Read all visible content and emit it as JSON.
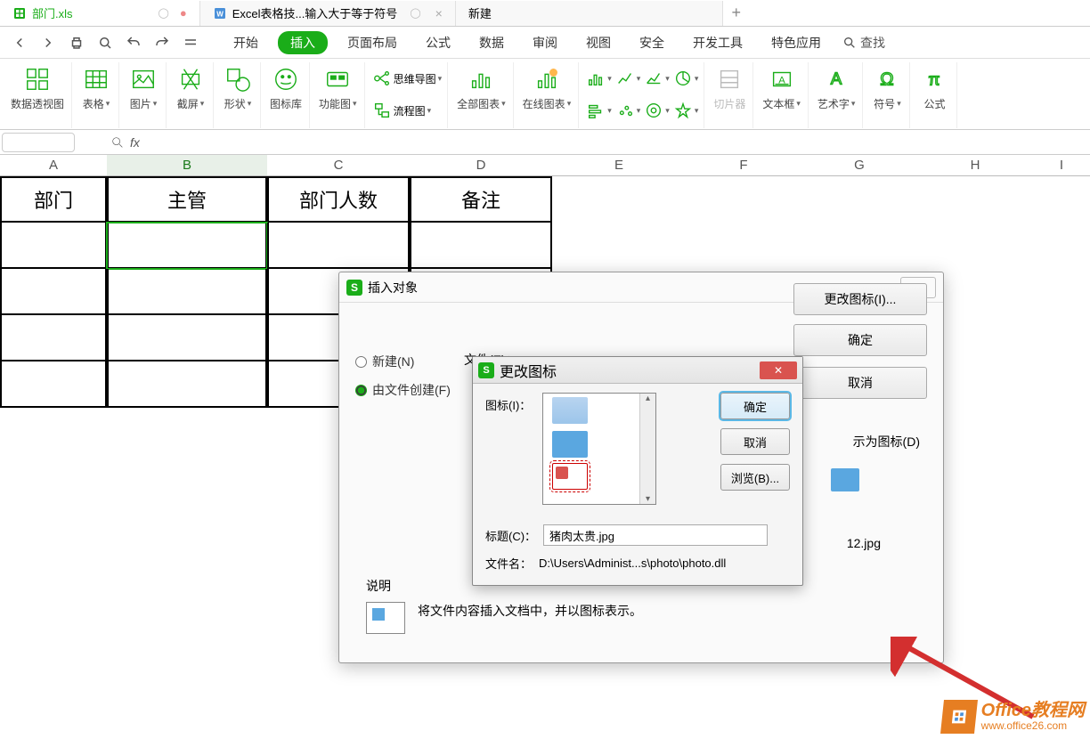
{
  "tabs": {
    "t1": "部门.xls",
    "t2": "Excel表格技...输入大于等于符号",
    "t3": "新建"
  },
  "menus": {
    "m1": "开始",
    "m2": "插入",
    "m3": "页面布局",
    "m4": "公式",
    "m5": "数据",
    "m6": "审阅",
    "m7": "视图",
    "m8": "安全",
    "m9": "开发工具",
    "m10": "特色应用",
    "find": "查找"
  },
  "ribbon": {
    "pivot": "数据透视图",
    "table": "表格",
    "pic": "图片",
    "screenshot": "截屏",
    "shape": "形状",
    "iconlib": "图标库",
    "func": "功能图",
    "mindmap": "思维导图",
    "flowchart": "流程图",
    "allchart": "全部图表",
    "onlinechart": "在线图表",
    "slice": "切片器",
    "textbox": "文本框",
    "wordart": "艺术字",
    "symbol": "符号",
    "formula": "公式"
  },
  "columns": {
    "A": "A",
    "B": "B",
    "C": "C",
    "D": "D",
    "E": "E",
    "F": "F",
    "G": "G",
    "H": "H",
    "I": "I"
  },
  "row1": {
    "A": "部门",
    "B": "主管",
    "C": "部门人数",
    "D": "备注"
  },
  "dlg1": {
    "title": "插入对象",
    "radio_new": "新建(N)",
    "radio_file": "由文件创建(F)",
    "file_label": "文件(E)：",
    "ok": "确定",
    "cancel": "取消",
    "asicon": "示为图标(D)",
    "filename": "12.jpg",
    "changeicon": "更改图标(I)...",
    "shuoming": "说明",
    "desc": "将文件内容插入文档中，并以图标表示。"
  },
  "dlg2": {
    "title": "更改图标",
    "icon_lbl": "图标(I)：",
    "ok": "确定",
    "cancel": "取消",
    "browse": "浏览(B)...",
    "label_lbl": "标题(C)：",
    "label_val": "猪肉太贵.jpg",
    "fname_lbl": "文件名：",
    "fname_val": "D:\\Users\\Administ...s\\photo\\photo.dll"
  },
  "wm": {
    "l1": "Office教程网",
    "l2": "www.office26.com"
  },
  "chart_data": null
}
